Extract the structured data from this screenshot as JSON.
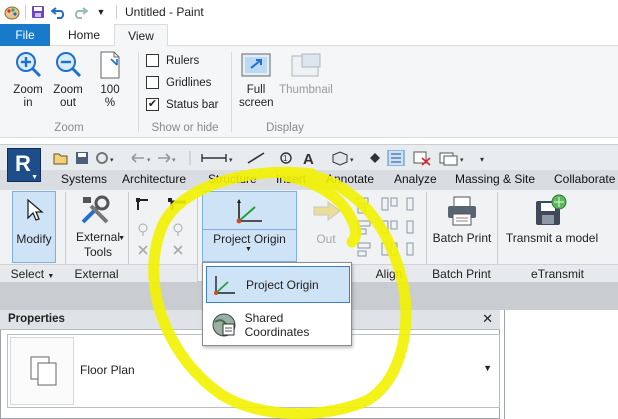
{
  "paint": {
    "window_title": "Untitled - Paint",
    "tabs": [
      {
        "label": "File",
        "active": false,
        "accent": "#1979ca"
      },
      {
        "label": "Home",
        "active": false
      },
      {
        "label": "View",
        "active": true
      }
    ],
    "zoom": {
      "zoom_in": "Zoom in",
      "zoom_out": "Zoom out",
      "hundred_percent": "100 %",
      "group": "Zoom"
    },
    "show_or_hide": {
      "rulers": {
        "label": "Rulers",
        "checked": false
      },
      "gridlines": {
        "label": "Gridlines",
        "checked": false
      },
      "status_bar": {
        "label": "Status bar",
        "checked": true
      },
      "group": "Show or hide"
    },
    "display": {
      "full_screen": "Full screen",
      "thumbnail": "Thumbnail",
      "group": "Display"
    }
  },
  "revit": {
    "app_button": "R",
    "tabs": [
      "Systems",
      "Architecture",
      "Structure",
      "Insert",
      "Annotate",
      "Analyze",
      "Massing & Site",
      "Collaborate"
    ],
    "ribbon": {
      "modify": "Modify",
      "external_tools": "External Tools",
      "project_origin": "Project Origin",
      "out": "Out",
      "batch_print": "Batch Print",
      "transmit_model": "Transmit a model"
    },
    "panels": {
      "select": "Select",
      "external": "External",
      "align": "Align",
      "batch_print": "Batch Print",
      "etransmit": "eTransmit"
    },
    "dropdown": {
      "items": [
        "Project Origin",
        "Shared Coordinates"
      ],
      "selected_index": 0
    },
    "properties": {
      "title": "Properties",
      "type_label": "Floor Plan"
    }
  },
  "annotation": {
    "color": "#f2f200"
  }
}
